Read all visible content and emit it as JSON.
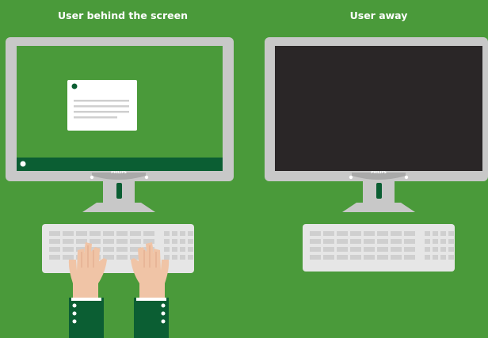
{
  "scenes": [
    {
      "heading": "User behind the screen",
      "screen_state": "active",
      "screen_color": "#4a9a3a"
    },
    {
      "heading": "User away",
      "screen_state": "off",
      "screen_color": "#2a2627"
    }
  ],
  "monitor_brand": "PHILIPS",
  "colors": {
    "background": "#4a9a3a",
    "bezel": "#c8c8c8",
    "taskbar": "#0b5e33",
    "sleeve": "#0b5e33",
    "skin": "#f0c4a6",
    "keyboard": "#e6e6e6",
    "keys": "#cfcfcf"
  }
}
